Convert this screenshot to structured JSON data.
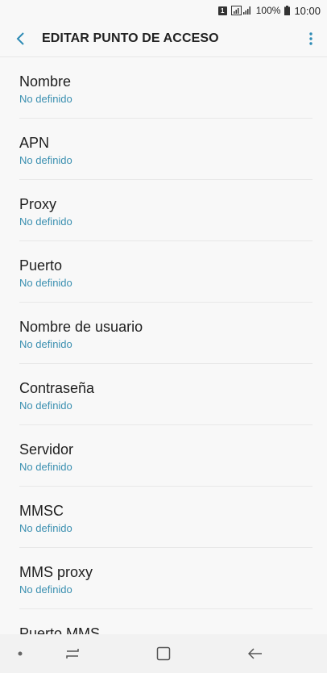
{
  "status_bar": {
    "sim_label": "1",
    "battery_percent": "100%",
    "time": "10:00"
  },
  "header": {
    "title": "EDITAR PUNTO DE ACCESO",
    "back_icon": "chevron-left-icon",
    "menu_icon": "more-vertical-icon",
    "accent_color": "#2e8bb5"
  },
  "fields": [
    {
      "label": "Nombre",
      "value": "No definido"
    },
    {
      "label": "APN",
      "value": "No definido"
    },
    {
      "label": "Proxy",
      "value": "No definido"
    },
    {
      "label": "Puerto",
      "value": "No definido"
    },
    {
      "label": "Nombre de usuario",
      "value": "No definido"
    },
    {
      "label": "Contraseña",
      "value": "No definido"
    },
    {
      "label": "Servidor",
      "value": "No definido"
    },
    {
      "label": "MMSC",
      "value": "No definido"
    },
    {
      "label": "MMS proxy",
      "value": "No definido"
    },
    {
      "label": "Puerto MMS",
      "value": ""
    }
  ],
  "nav_bar": {
    "icons": [
      "dot-icon",
      "recents-icon",
      "home-icon",
      "back-arrow-icon"
    ]
  }
}
